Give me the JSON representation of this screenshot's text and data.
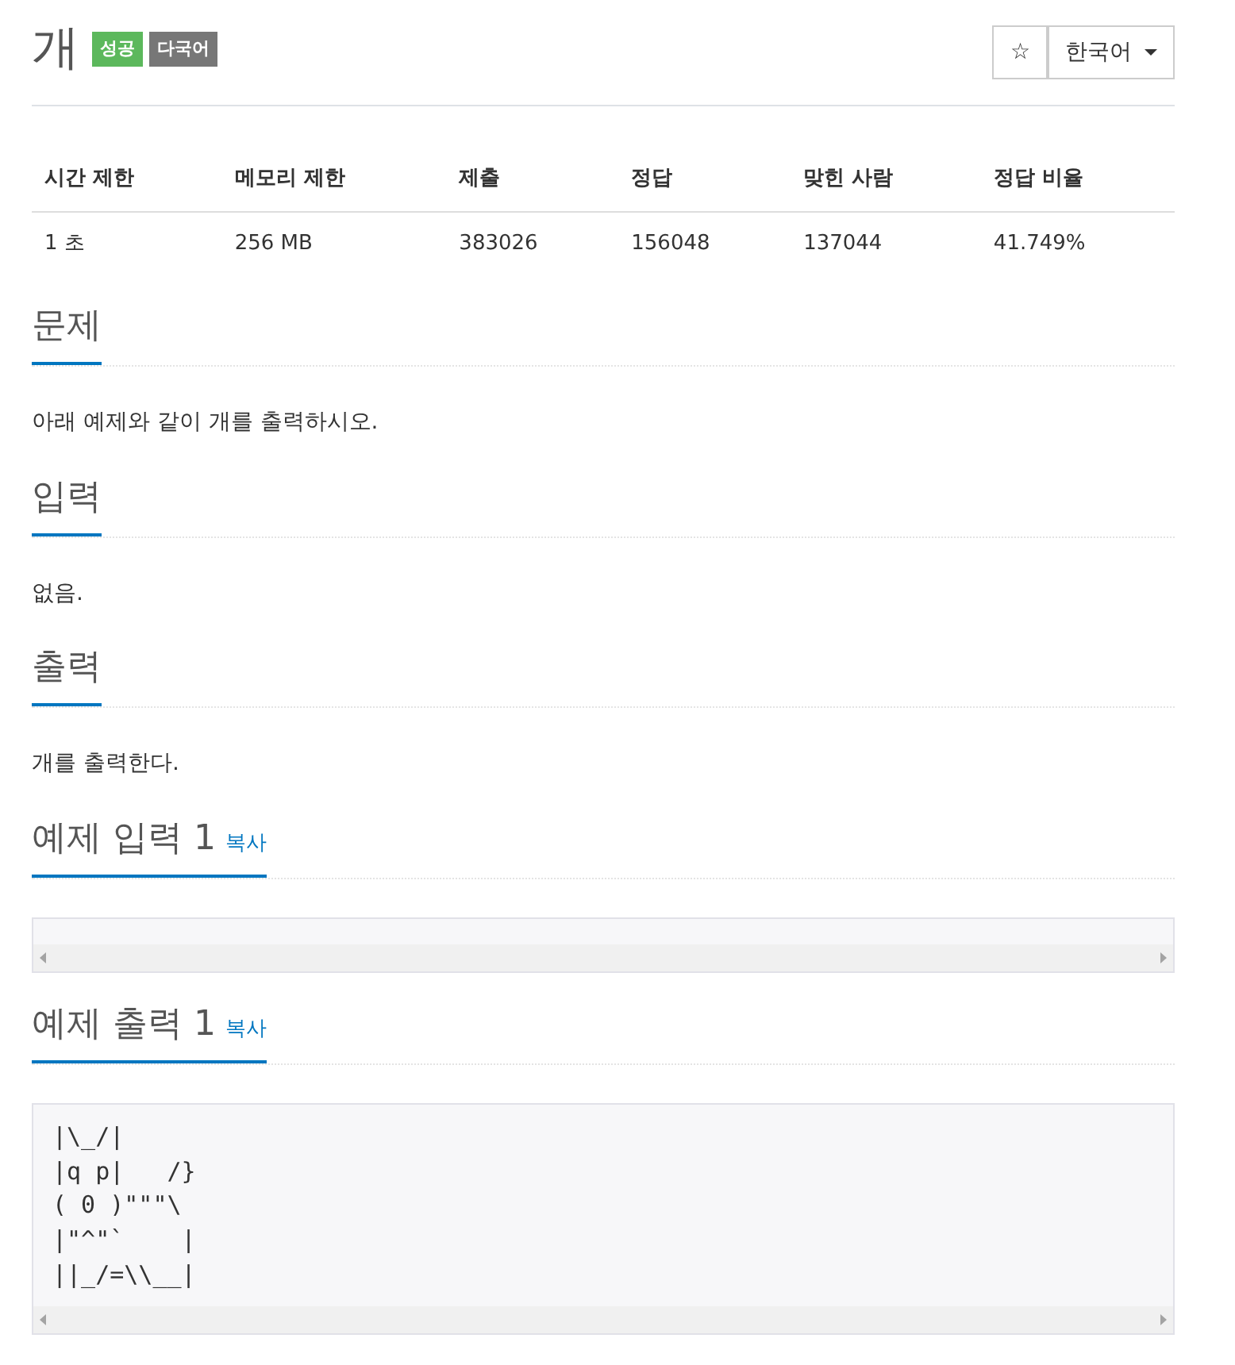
{
  "title": "개",
  "badges": [
    {
      "text": "성공",
      "color": "#5cb85c"
    },
    {
      "text": "다국어",
      "color": "#777777"
    }
  ],
  "star_button": "☆",
  "language": "한국어",
  "info_table": {
    "columns": [
      "시간 제한",
      "메모리 제한",
      "제출",
      "정답",
      "맞힌 사람",
      "정답 비율"
    ],
    "rows": [
      [
        "1 초",
        "256 MB",
        "383026",
        "156048",
        "137044",
        "41.749%"
      ]
    ]
  },
  "sections": [
    {
      "kind": "text",
      "heading": "문제",
      "body": "아래 예제와 같이 개를 출력하시오."
    },
    {
      "kind": "text",
      "heading": "입력",
      "body": "없음."
    },
    {
      "kind": "text",
      "heading": "출력",
      "body": "개를 출력한다."
    },
    {
      "kind": "sample",
      "heading": "예제 입력 1",
      "copy": "복사"
    },
    {
      "kind": "sample",
      "heading": "예제 출력 1",
      "copy": "복사",
      "body": "|\\_/|\n|q p|   /}\n( 0 )\"\"\"\\\n|\"^\"`    |\n||_/=\\\\__|"
    }
  ]
}
